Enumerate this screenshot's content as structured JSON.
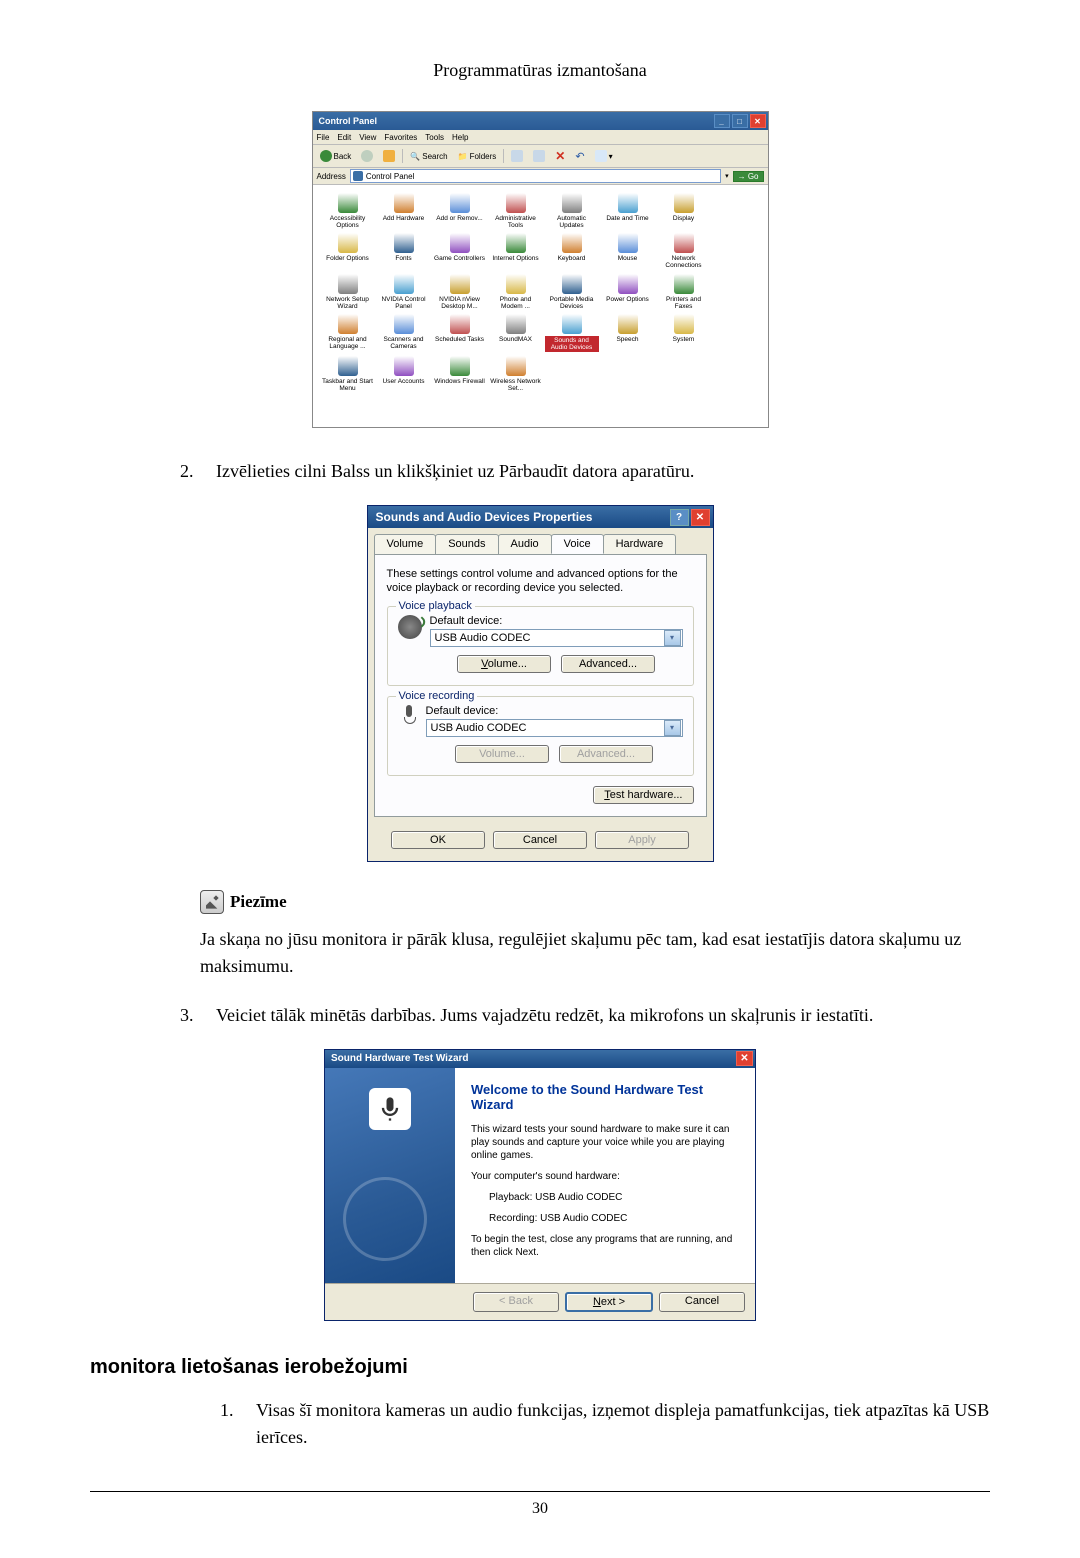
{
  "header": {
    "title": "Programmatūras izmantošana"
  },
  "control_panel": {
    "title": "Control Panel",
    "menus": [
      "File",
      "Edit",
      "View",
      "Favorites",
      "Tools",
      "Help"
    ],
    "toolbar": {
      "back": "Back",
      "search": "Search",
      "folders": "Folders"
    },
    "address_label": "Address",
    "address_value": "Control Panel",
    "go": "Go",
    "items": [
      "Accessibility Options",
      "Add Hardware",
      "Add or Remov...",
      "Administrative Tools",
      "Automatic Updates",
      "Date and Time",
      "Display",
      "Folder Options",
      "Fonts",
      "Game Controllers",
      "Internet Options",
      "Keyboard",
      "Mouse",
      "Network Connections",
      "Network Setup Wizard",
      "NVIDIA Control Panel",
      "NVIDIA nView Desktop M...",
      "Phone and Modem ...",
      "Portable Media Devices",
      "Power Options",
      "Printers and Faxes",
      "Regional and Language ...",
      "Scanners and Cameras",
      "Scheduled Tasks",
      "SoundMAX",
      "Sounds and Audio Devices",
      "Speech",
      "System",
      "Taskbar and Start Menu",
      "User Accounts",
      "Windows Firewall",
      "Wireless Network Set..."
    ],
    "highlight": "Sounds and Audio Devices"
  },
  "steps": {
    "s2_num": "2.",
    "s2_text": "Izvēlieties cilni Balss un klikšķiniet uz Pārbaudīt datora aparatūru.",
    "s3_num": "3.",
    "s3_text": "Veiciet tālāk minētās darbības. Jums vajadzētu redzēt, ka mikrofons un skaļrunis ir iestatīti."
  },
  "sounds_dialog": {
    "title": "Sounds and Audio Devices Properties",
    "tabs": [
      "Volume",
      "Sounds",
      "Audio",
      "Voice",
      "Hardware"
    ],
    "active_tab": "Voice",
    "description": "These settings control volume and advanced options for the voice playback or recording device you selected.",
    "playback_legend": "Voice playback",
    "recording_legend": "Voice recording",
    "default_device_label": "Default device:",
    "device_value": "USB Audio CODEC",
    "volume_btn": "Volume...",
    "advanced_btn": "Advanced...",
    "volume_btn_u": "Volume...",
    "advanced_btn_u": "Advanced...",
    "test_hw_btn": "Test hardware...",
    "ok": "OK",
    "cancel": "Cancel",
    "apply": "Apply"
  },
  "note": {
    "label": "Piezīme",
    "text": "Ja skaņa no jūsu monitora ir pārāk klusa, regulējiet skaļumu pēc tam, kad esat iestatījis datora skaļumu uz maksimumu."
  },
  "wizard": {
    "title": "Sound Hardware Test Wizard",
    "heading": "Welcome to the Sound Hardware Test Wizard",
    "p1": "This wizard tests your sound hardware to make sure it can play sounds and capture your voice while you are playing online games.",
    "p2": "Your computer's sound hardware:",
    "playback_line": "Playback: USB Audio CODEC",
    "recording_line": "Recording: USB Audio CODEC",
    "p3": "To begin the test, close any programs that are running, and then click Next.",
    "back": "< Back",
    "next": "Next >",
    "cancel": "Cancel"
  },
  "section": {
    "heading": "monitora lietošanas ierobežojumi",
    "s1_num": "1.",
    "s1_text": "Visas šī monitora kameras un audio funkcijas, izņemot displeja pamatfunkcijas, tiek atpazītas kā USB ierīces."
  },
  "page_number": "30"
}
